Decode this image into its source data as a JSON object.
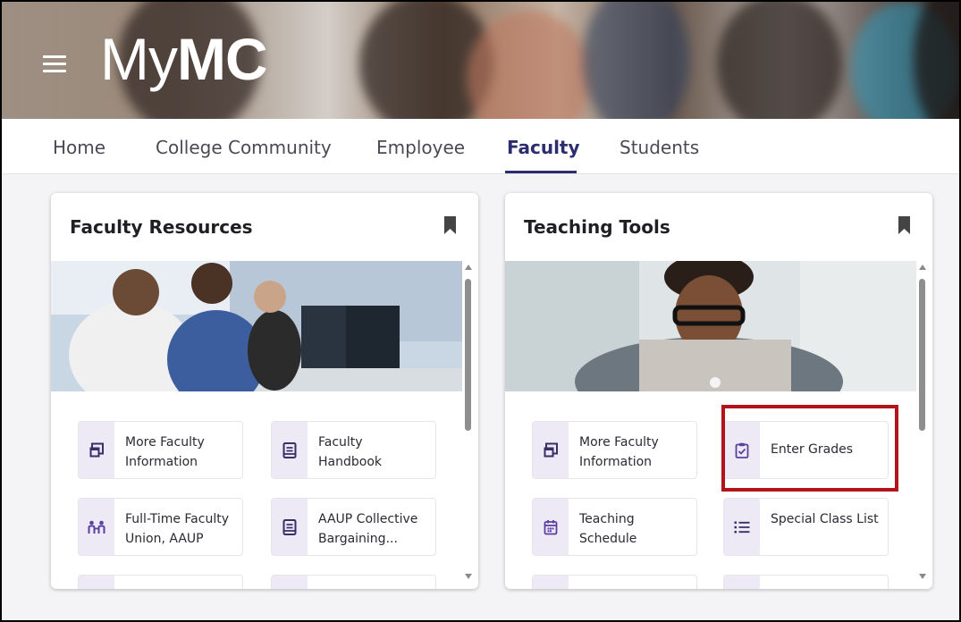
{
  "header": {
    "logo_light": "My",
    "logo_bold": "MC"
  },
  "nav": {
    "tabs": [
      {
        "label": "Home"
      },
      {
        "label": "College Community"
      },
      {
        "label": "Employee"
      },
      {
        "label": "Faculty"
      },
      {
        "label": "Students"
      }
    ],
    "active_tab": "Faculty"
  },
  "cards": [
    {
      "title": "Faculty Resources",
      "tiles": [
        {
          "label": "More Faculty Information",
          "icon": "window-stack-icon"
        },
        {
          "label": "Faculty Handbook",
          "icon": "handbook-icon"
        },
        {
          "label": "Full-Time Faculty Union, AAUP",
          "icon": "people-union-icon"
        },
        {
          "label": "AAUP Collective Bargaining...",
          "icon": "document-icon"
        }
      ]
    },
    {
      "title": "Teaching Tools",
      "tiles": [
        {
          "label": "More Faculty Information",
          "icon": "window-stack-icon"
        },
        {
          "label": "Enter Grades",
          "icon": "clipboard-check-icon"
        },
        {
          "label": "Teaching Schedule",
          "icon": "calendar-icon"
        },
        {
          "label": "Special Class List",
          "icon": "list-icon"
        }
      ]
    }
  ],
  "colors": {
    "brand_navy": "#2b2d6e",
    "icon_purple": "#5a4a8a",
    "icon_bg": "#eeeaf5",
    "highlight_red": "#b3141b"
  }
}
